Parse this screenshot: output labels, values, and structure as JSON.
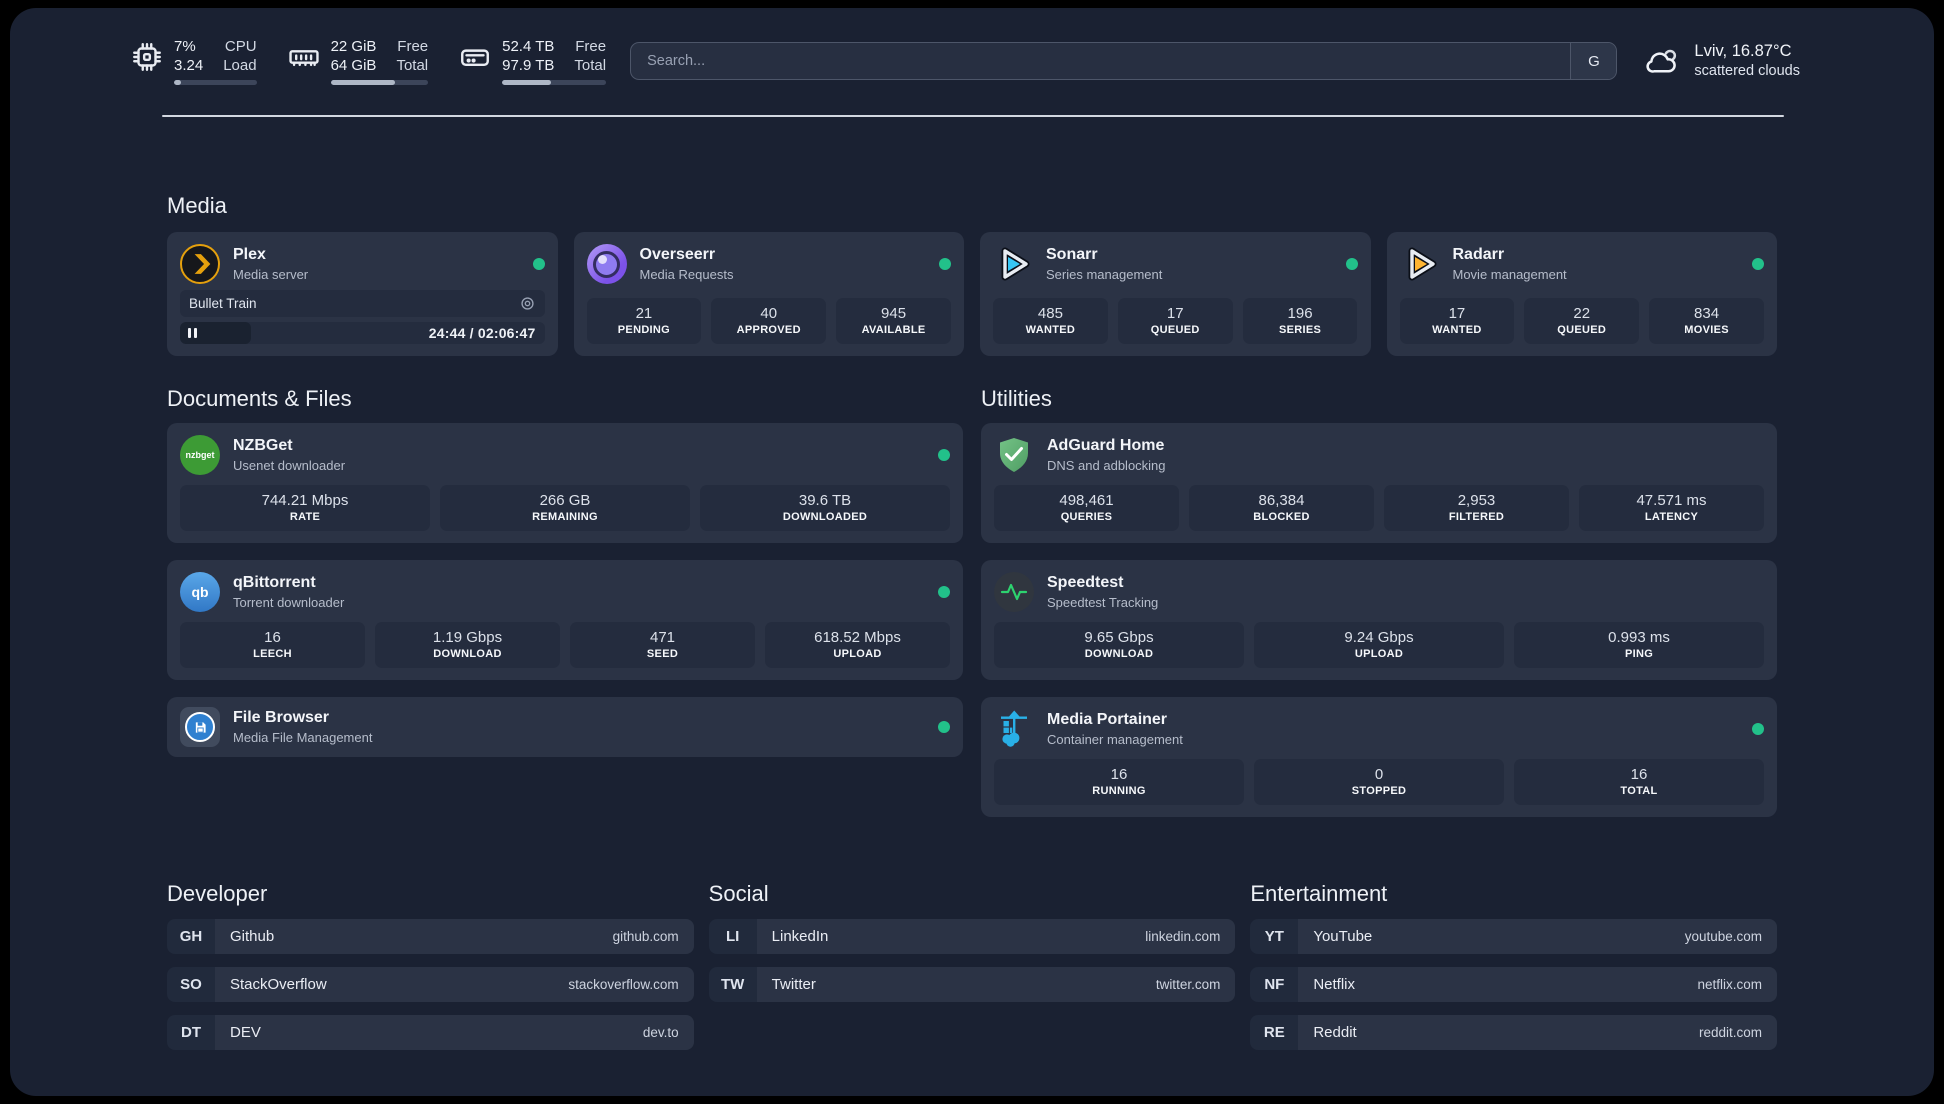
{
  "header": {
    "metrics": [
      {
        "icon": "cpu-icon",
        "value_top": "7%",
        "value_bottom": "3.24",
        "label_top": "CPU",
        "label_bottom": "Load",
        "progress_pct": 8
      },
      {
        "icon": "memory-icon",
        "value_top": "22 GiB",
        "value_bottom": "64 GiB",
        "label_top": "Free",
        "label_bottom": "Total",
        "progress_pct": 66
      },
      {
        "icon": "disk-icon",
        "value_top": "52.4 TB",
        "value_bottom": "97.9 TB",
        "label_top": "Free",
        "label_bottom": "Total",
        "progress_pct": 47
      }
    ],
    "search": {
      "placeholder": "Search...",
      "engine_button": "G"
    },
    "weather": {
      "location_temp": "Lviv, 16.87°C",
      "condition": "scattered clouds"
    }
  },
  "colors": {
    "status_online": "#22c18a",
    "plex_accent": "#e5a00d",
    "sonarr_accent": "#36c6f4",
    "radarr_accent": "#ffb532",
    "portainer_accent": "#29b0e7",
    "speedtest_accent": "#2dd36f"
  },
  "media": {
    "section_title": "Media",
    "plex": {
      "title": "Plex",
      "subtitle": "Media server",
      "online": true,
      "now_playing": "Bullet Train",
      "time_display": "24:44 / 02:06:47",
      "progress_pct": 19.5
    },
    "cards": [
      {
        "icon": "overseerr-icon",
        "title": "Overseerr",
        "subtitle": "Media Requests",
        "online": true,
        "stats": [
          {
            "value": "21",
            "label": "PENDING"
          },
          {
            "value": "40",
            "label": "APPROVED"
          },
          {
            "value": "945",
            "label": "AVAILABLE"
          }
        ]
      },
      {
        "icon": "sonarr-icon",
        "title": "Sonarr",
        "subtitle": "Series management",
        "online": true,
        "stats": [
          {
            "value": "485",
            "label": "WANTED"
          },
          {
            "value": "17",
            "label": "QUEUED"
          },
          {
            "value": "196",
            "label": "SERIES"
          }
        ]
      },
      {
        "icon": "radarr-icon",
        "title": "Radarr",
        "subtitle": "Movie management",
        "online": true,
        "stats": [
          {
            "value": "17",
            "label": "WANTED"
          },
          {
            "value": "22",
            "label": "QUEUED"
          },
          {
            "value": "834",
            "label": "MOVIES"
          }
        ]
      }
    ]
  },
  "documents": {
    "section_title": "Documents & Files",
    "cards": [
      {
        "icon": "nzbget-icon",
        "icon_text": "nzbget",
        "title": "NZBGet",
        "subtitle": "Usenet downloader",
        "online": true,
        "stats": [
          {
            "value": "744.21 Mbps",
            "label": "RATE"
          },
          {
            "value": "266 GB",
            "label": "REMAINING"
          },
          {
            "value": "39.6 TB",
            "label": "DOWNLOADED"
          }
        ]
      },
      {
        "icon": "qbittorrent-icon",
        "icon_text": "qb",
        "title": "qBittorrent",
        "subtitle": "Torrent downloader",
        "online": true,
        "stats": [
          {
            "value": "16",
            "label": "LEECH"
          },
          {
            "value": "1.19 Gbps",
            "label": "DOWNLOAD"
          },
          {
            "value": "471",
            "label": "SEED"
          },
          {
            "value": "618.52 Mbps",
            "label": "UPLOAD"
          }
        ]
      },
      {
        "icon": "filebrowser-icon",
        "title": "File Browser",
        "subtitle": "Media File Management",
        "online": true,
        "stats": []
      }
    ]
  },
  "utilities": {
    "section_title": "Utilities",
    "cards": [
      {
        "icon": "adguard-icon",
        "title": "AdGuard Home",
        "subtitle": "DNS and adblocking",
        "online": false,
        "stats": [
          {
            "value": "498,461",
            "label": "QUERIES"
          },
          {
            "value": "86,384",
            "label": "BLOCKED"
          },
          {
            "value": "2,953",
            "label": "FILTERED"
          },
          {
            "value": "47.571 ms",
            "label": "LATENCY"
          }
        ]
      },
      {
        "icon": "speedtest-icon",
        "title": "Speedtest",
        "subtitle": "Speedtest Tracking",
        "online": false,
        "stats": [
          {
            "value": "9.65 Gbps",
            "label": "DOWNLOAD"
          },
          {
            "value": "9.24 Gbps",
            "label": "UPLOAD"
          },
          {
            "value": "0.993 ms",
            "label": "PING"
          }
        ]
      },
      {
        "icon": "portainer-icon",
        "title": "Media Portainer",
        "subtitle": "Container management",
        "online": true,
        "stats": [
          {
            "value": "16",
            "label": "RUNNING"
          },
          {
            "value": "0",
            "label": "STOPPED"
          },
          {
            "value": "16",
            "label": "TOTAL"
          }
        ]
      }
    ]
  },
  "bookmarks": [
    {
      "section_title": "Developer",
      "links": [
        {
          "abbr": "GH",
          "name": "Github",
          "url": "github.com"
        },
        {
          "abbr": "SO",
          "name": "StackOverflow",
          "url": "stackoverflow.com"
        },
        {
          "abbr": "DT",
          "name": "DEV",
          "url": "dev.to"
        }
      ]
    },
    {
      "section_title": "Social",
      "links": [
        {
          "abbr": "LI",
          "name": "LinkedIn",
          "url": "linkedin.com"
        },
        {
          "abbr": "TW",
          "name": "Twitter",
          "url": "twitter.com"
        }
      ]
    },
    {
      "section_title": "Entertainment",
      "links": [
        {
          "abbr": "YT",
          "name": "YouTube",
          "url": "youtube.com"
        },
        {
          "abbr": "NF",
          "name": "Netflix",
          "url": "netflix.com"
        },
        {
          "abbr": "RE",
          "name": "Reddit",
          "url": "reddit.com"
        }
      ]
    }
  ]
}
